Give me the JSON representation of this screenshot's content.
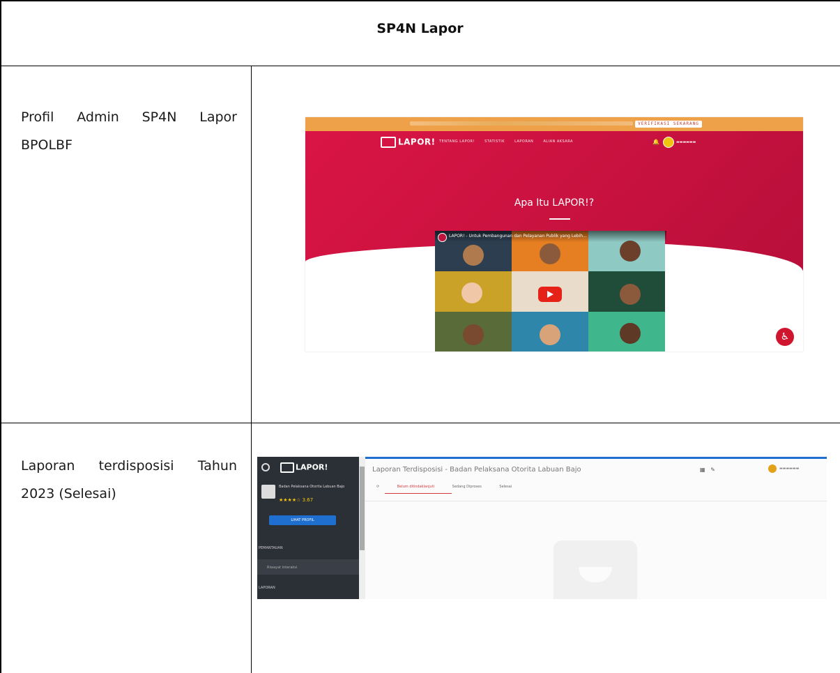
{
  "header": {
    "title": "SP4N Lapor"
  },
  "rows": [
    {
      "label_line1": "Profil Admin SP4N Lapor",
      "label_line2": "BPOLBF"
    },
    {
      "label_line1": "Laporan terdisposisi Tahun",
      "label_line2": "2023 (Selesai)"
    }
  ],
  "screenshot1": {
    "topbar_button": "VERIFIKASI SEKARANG",
    "logo": "LAPOR!",
    "nav_items": [
      "TENTANG LAPOR!",
      "STATISTIK",
      "LAPORAN",
      "ALIAN AKSARA"
    ],
    "hero_title": "Apa Itu LAPOR!?",
    "video_title": "LAPOR! - Untuk Pembangunan dan Pelayanan Publik yang Lebih..."
  },
  "screenshot2": {
    "logo": "LAPOR!",
    "org_name": "Badan Pelaksana Otorita Labuan Bajo",
    "stars": "★★★★☆ 3.67",
    "button": "LIHAT PROFIL",
    "section1": "PEMANTAUAN",
    "sub_item": "Riwayat Interaksi",
    "section2": "LAPORAN",
    "page_title": "Laporan Terdisposisi - Badan Pelaksana Otorita Labuan Bajo",
    "tabs": [
      "Belum ditindaklanjuti",
      "Sedang Diproses",
      "Selesai"
    ]
  },
  "colors": {
    "lapor_red": "#cc1240",
    "topbar_orange": "#efa14a",
    "sidebar_dark": "#2b2f36",
    "accent_blue": "#1f6fd1"
  }
}
